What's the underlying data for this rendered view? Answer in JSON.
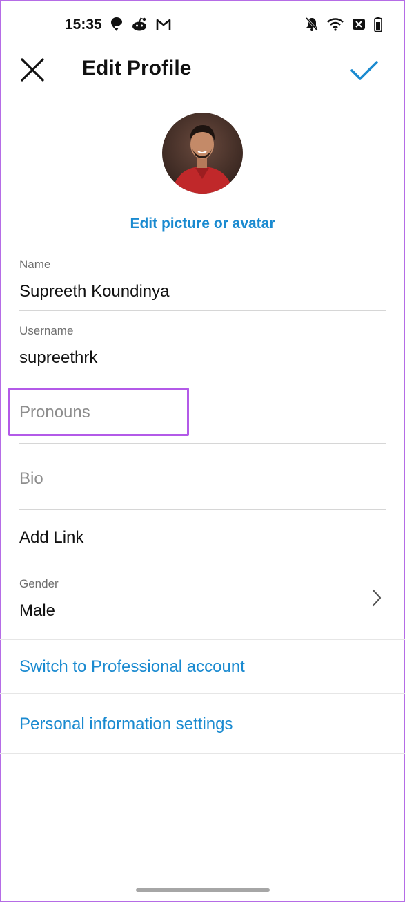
{
  "status_bar": {
    "time": "15:35",
    "left_icons": [
      "swiggy-icon",
      "reddit-icon",
      "gmail-icon"
    ],
    "right_icons": [
      "mute-bell-icon",
      "wifi-icon",
      "sim-off-icon",
      "battery-icon"
    ]
  },
  "header": {
    "title": "Edit Profile",
    "close_icon": "close-icon",
    "done_icon": "check-icon"
  },
  "profile": {
    "edit_picture_label": "Edit picture or avatar"
  },
  "fields": {
    "name": {
      "label": "Name",
      "value": "Supreeth Koundinya"
    },
    "username": {
      "label": "Username",
      "value": "supreethrk"
    },
    "pronouns": {
      "placeholder": "Pronouns"
    },
    "bio": {
      "placeholder": "Bio"
    },
    "add_link": {
      "label": "Add Link"
    },
    "gender": {
      "label": "Gender",
      "value": "Male"
    }
  },
  "links": {
    "professional": "Switch to Professional account",
    "personal_info": "Personal information settings"
  },
  "colors": {
    "accent": "#1a8ad0",
    "highlight": "#b35ae8",
    "frame": "#b56ce6"
  }
}
